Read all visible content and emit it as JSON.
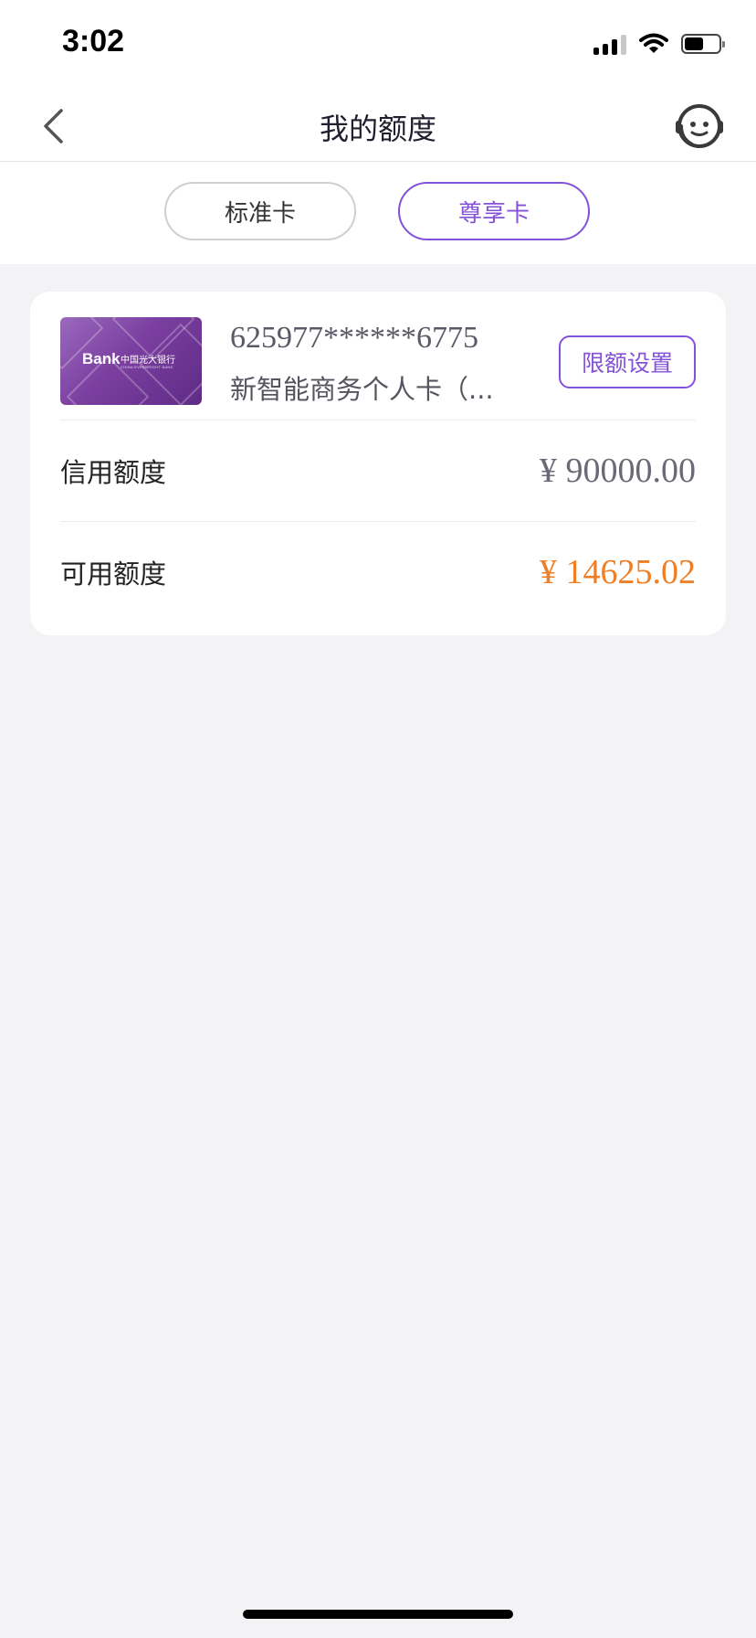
{
  "status_bar": {
    "time": "3:02"
  },
  "nav": {
    "title": "我的额度"
  },
  "tabs": [
    {
      "label": "标准卡",
      "selected": false
    },
    {
      "label": "尊享卡",
      "selected": true
    }
  ],
  "card": {
    "number": "625977******6775",
    "name": "新智能商务个人卡（...",
    "limit_button": "限额设置",
    "image_logo": "Bank",
    "image_bank_name": "中国光大银行",
    "image_bank_name_en": "CHINA EVERBRIGHT BANK"
  },
  "rows": [
    {
      "label": "信用额度",
      "value": "¥ 90000.00"
    },
    {
      "label": "可用额度",
      "value": "¥ 14625.02"
    }
  ],
  "colors": {
    "accent": "#8451d8",
    "available_amount": "#ee7f26",
    "background": "#f3f3f6"
  }
}
